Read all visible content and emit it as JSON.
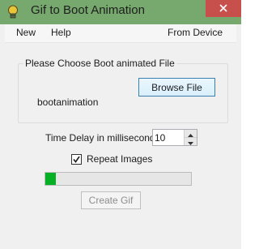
{
  "window": {
    "title": "Gif to Boot Animation",
    "icon": "lightbulb-app-icon",
    "titlebar_color": "#77a86d",
    "close_color": "#c7504d"
  },
  "menu": {
    "new_label": "New",
    "help_label": "Help",
    "from_device_label": "From Device"
  },
  "file_group": {
    "legend": "Please Choose Boot animated File",
    "browse_label": "Browse File",
    "file_name": "bootanimation"
  },
  "delay": {
    "label": "Time Delay in milliseconds",
    "value": "10"
  },
  "repeat": {
    "label": "Repeat Images",
    "checked": true
  },
  "progress": {
    "fraction": 0.07,
    "color": "#06b025"
  },
  "create": {
    "label": "Create Gif",
    "enabled": false
  }
}
